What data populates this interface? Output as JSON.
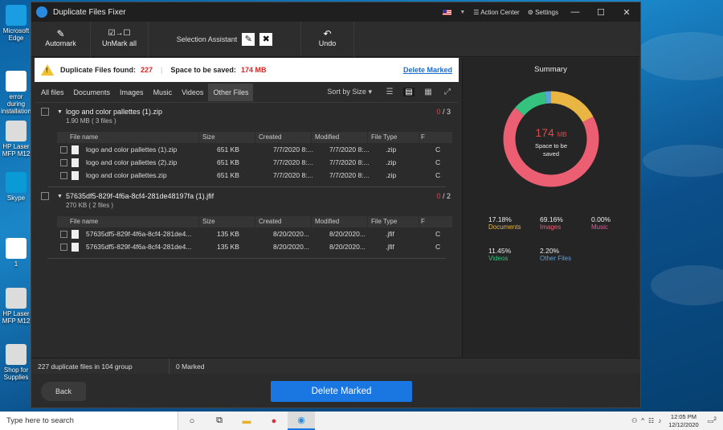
{
  "desktop": {
    "icons": [
      {
        "label": "Microsoft Edge",
        "color": "#1b9de2"
      },
      {
        "label": "error during installation",
        "color": "#ffffff"
      },
      {
        "label": "HP Laser MFP M12",
        "color": "#dcdcdc"
      },
      {
        "label": "Skype",
        "color": "#0a9ad6"
      },
      {
        "label": "1",
        "color": "#ffffff"
      },
      {
        "label": "HP Laser MFP M12",
        "color": "#dcdcdc"
      },
      {
        "label": "Shop for Supplies",
        "color": "#dcdcdc"
      }
    ]
  },
  "window": {
    "title": "Duplicate Files Fixer",
    "action_center": "Action Center",
    "settings": "Settings",
    "minimize": "—",
    "maximize": "☐",
    "close": "✕"
  },
  "toolbar": {
    "automark": "Automark",
    "unmark_all": "UnMark all",
    "selection_assistant": "Selection Assistant",
    "undo": "Undo"
  },
  "infobar": {
    "found_label": "Duplicate Files found:",
    "found_value": "227",
    "space_label": "Space to be saved:",
    "space_value": "174 MB",
    "delete_marked": "Delete Marked"
  },
  "tabs": [
    "All files",
    "Documents",
    "Images",
    "Music",
    "Videos",
    "Other Files"
  ],
  "active_tab": "Other Files",
  "sort_by": "Sort by Size",
  "columns": [
    "File name",
    "Size",
    "Created",
    "Modified",
    "File Type",
    "F"
  ],
  "groups": [
    {
      "name": "logo and color pallettes (1).zip",
      "size": "1.90 MB",
      "count_text": "( 3 files )",
      "selected": "0",
      "total": "/ 3",
      "files": [
        {
          "name": "logo and color pallettes (1).zip",
          "size": "651 KB",
          "created": "7/7/2020 8:...",
          "modified": "7/7/2020 8:...",
          "type": ".zip",
          "f": "C"
        },
        {
          "name": "logo and color pallettes (2).zip",
          "size": "651 KB",
          "created": "7/7/2020 8:...",
          "modified": "7/7/2020 8:...",
          "type": ".zip",
          "f": "C"
        },
        {
          "name": "logo and color pallettes.zip",
          "size": "651 KB",
          "created": "7/7/2020 8:...",
          "modified": "7/7/2020 8:...",
          "type": ".zip",
          "f": "C"
        }
      ]
    },
    {
      "name": "57635df5-829f-4f6a-8cf4-281de48197fa (1).jfif",
      "size": "270 KB",
      "count_text": "( 2 files )",
      "selected": "0",
      "total": "/ 2",
      "files": [
        {
          "name": "57635df5-829f-4f6a-8cf4-281de4...",
          "size": "135 KB",
          "created": "8/20/2020...",
          "modified": "8/20/2020...",
          "type": ".jfif",
          "f": "C"
        },
        {
          "name": "57635df5-829f-4f6a-8cf4-281de4...",
          "size": "135 KB",
          "created": "8/20/2020...",
          "modified": "8/20/2020...",
          "type": ".jfif",
          "f": "C"
        }
      ]
    }
  ],
  "summary": {
    "title": "Summary",
    "center_value": "174",
    "center_unit": "MB",
    "center_label": "Space to be saved",
    "segments": [
      {
        "label": "Documents",
        "pct": "17.18%",
        "value": 17.18,
        "color": "#e9b643"
      },
      {
        "label": "Images",
        "pct": "69.16%",
        "value": 69.16,
        "color": "#ec5f73"
      },
      {
        "label": "Music",
        "pct": "0.00%",
        "value": 0.0,
        "color": "#e25aa0"
      },
      {
        "label": "Videos",
        "pct": "11.45%",
        "value": 11.45,
        "color": "#35c27f"
      },
      {
        "label": "Other Files",
        "pct": "2.20%",
        "value": 2.2,
        "color": "#5aa2e0"
      }
    ]
  },
  "status": {
    "duplicates": "227 duplicate files in 104 group",
    "marked": "0 Marked"
  },
  "buttons": {
    "back": "Back",
    "delete_marked": "Delete Marked"
  },
  "taskbar": {
    "search_placeholder": "Type here to search",
    "time": "12:05 PM",
    "date": "12/12/2020",
    "notification_count": "2"
  }
}
